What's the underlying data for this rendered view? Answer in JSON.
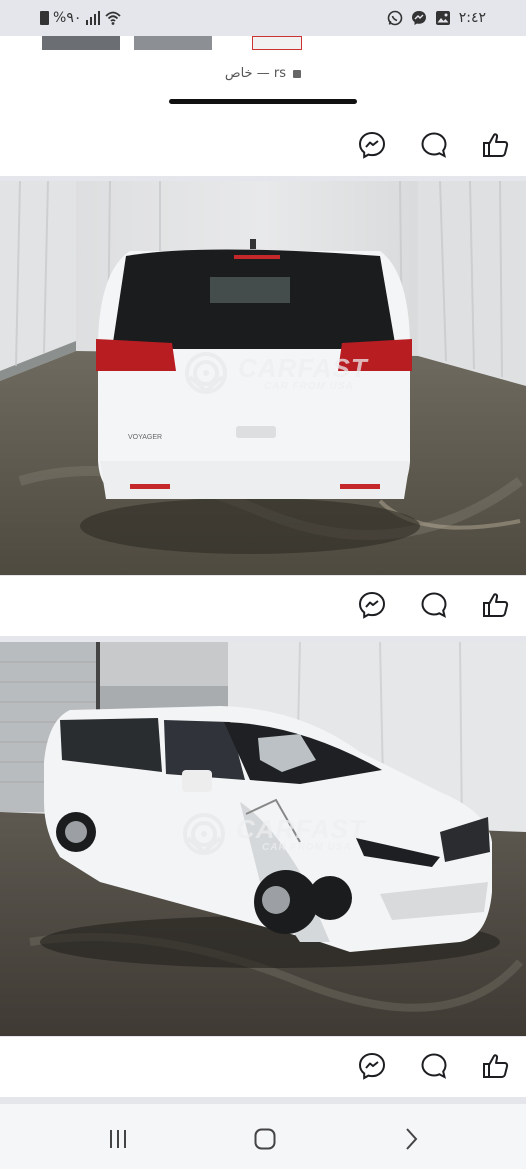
{
  "status_bar": {
    "battery_text": "%٩٠",
    "time": "٢:٤٢",
    "icons": [
      "battery-icon",
      "signal-icon",
      "wifi-icon",
      "whatsapp-icon",
      "messenger-icon",
      "gallery-icon"
    ]
  },
  "address_bar": {
    "site_text": "خاص — rs",
    "lock_icon": "lock-icon"
  },
  "post_actions": {
    "icons": [
      "messenger-share-icon",
      "comment-icon",
      "like-icon"
    ]
  },
  "photos": [
    {
      "watermark_brand": "CARFAST",
      "watermark_sub": "CAR FROM USA",
      "badge_text": "VOYAGER"
    },
    {
      "watermark_brand": "CARFAST",
      "watermark_sub": "CAR FROM USA"
    }
  ],
  "colors": {
    "bar_bg": "#e4e6eb",
    "card_bg": "#ffffff",
    "icon_stroke": "#1c1e21"
  },
  "navigation": {
    "buttons": [
      "recent-apps-button",
      "home-button",
      "back-button"
    ]
  }
}
